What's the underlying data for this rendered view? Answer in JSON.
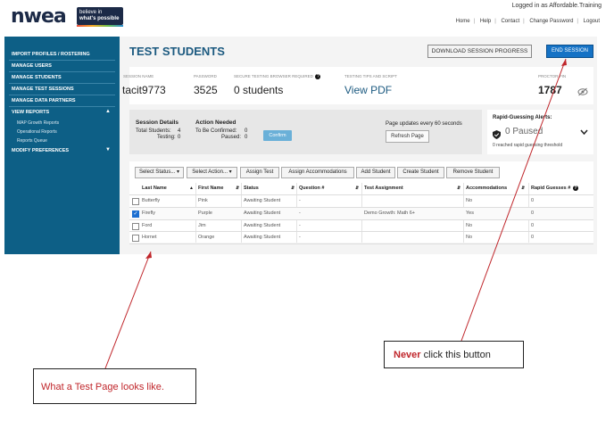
{
  "header": {
    "logo": "nwea",
    "tagline_line1": "believe in",
    "tagline_line2": "what's possible",
    "logged_in": "Logged in as Affordable.Training",
    "nav": [
      "Home",
      "Help",
      "Contact",
      "Change Password",
      "Logout"
    ]
  },
  "sidebar": {
    "items": [
      "IMPORT PROFILES / ROSTERING",
      "MANAGE USERS",
      "MANAGE STUDENTS",
      "MANAGE TEST SESSIONS",
      "MANAGE DATA PARTNERS",
      "VIEW REPORTS",
      "MODIFY PREFERENCES"
    ],
    "report_subitems": [
      "MAP Growth Reports",
      "Operational Reports",
      "Reports Queue"
    ]
  },
  "main": {
    "title": "TEST STUDENTS",
    "download_button": "DOWNLOAD SESSION PROGRESS",
    "end_session_button": "END SESSION"
  },
  "session": {
    "name_label": "SESSION NAME",
    "name": "tacit9773",
    "password_label": "PASSWORD",
    "password": "3525",
    "browser_label": "SECURE TESTING BROWSER REQUIRED",
    "browser_value": "0 students",
    "tips_label": "TESTING TIPS AND SCRIPT",
    "tips_link": "View PDF",
    "proctor_label": "PROCTOR PIN",
    "proctor_pin": "1787"
  },
  "details": {
    "heading": "Session Details",
    "total_label": "Total Students:",
    "total": "4",
    "testing_label": "Testing:",
    "testing": "0",
    "action_heading": "Action Needed",
    "confirmed_label": "To Be Confirmed:",
    "confirmed": "0",
    "paused_label": "Paused:",
    "paused": "0",
    "confirm_button": "Confirm",
    "update_text": "Page updates every 60 seconds",
    "refresh_button": "Refresh Page"
  },
  "rapid_guessing": {
    "title": "Rapid-Guessing Alerts:",
    "status": "0 Paused",
    "note": "0 reached rapid guessing threshold"
  },
  "toolbar": {
    "select_status": "Select Status...",
    "select_action": "Select Action...",
    "buttons": [
      "Assign Test",
      "Assign Accommodations",
      "Add Student",
      "Create Student",
      "Remove Student"
    ]
  },
  "table": {
    "columns": [
      "Last Name",
      "First Name",
      "Status",
      "Question #",
      "Test Assignment",
      "Accommodations",
      "Rapid Guesses #"
    ],
    "rows": [
      {
        "last": "Butterfly",
        "first": "Pink",
        "status": "Awaiting Student",
        "question": "-",
        "test": "",
        "accom": "No",
        "rapid": "0",
        "checked": false
      },
      {
        "last": "Firefly",
        "first": "Purple",
        "status": "Awaiting Student",
        "question": "-",
        "test": "Demo Growth: Math 6+",
        "accom": "Yes",
        "rapid": "0",
        "checked": true
      },
      {
        "last": "Ford",
        "first": "Jim",
        "status": "Awaiting Student",
        "question": "-",
        "test": "",
        "accom": "No",
        "rapid": "0",
        "checked": false
      },
      {
        "last": "Hornet",
        "first": "Orange",
        "status": "Awaiting Student",
        "question": "-",
        "test": "",
        "accom": "No",
        "rapid": "0",
        "checked": false
      }
    ]
  },
  "annotations": {
    "never_bold": "Never",
    "never_rest": " click this button",
    "test_page": "What a Test Page looks like."
  },
  "colors": {
    "sidebar": "#0d5f86",
    "accent_blue": "#1572c5",
    "annotation_red": "#c0262b"
  }
}
